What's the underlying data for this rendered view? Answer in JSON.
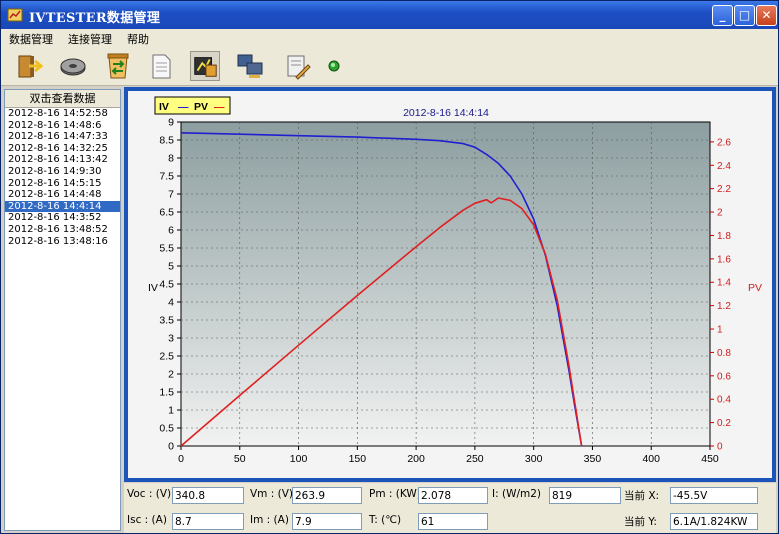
{
  "window": {
    "title": "IVTESTER数据管理",
    "min": "_",
    "max": "□",
    "close": "✕"
  },
  "menu": [
    "数据管理",
    "连接管理",
    "帮助"
  ],
  "toolbar": [
    {
      "name": "exit-icon"
    },
    {
      "name": "disc-icon"
    },
    {
      "name": "trash-recycle-icon"
    },
    {
      "name": "document-icon"
    },
    {
      "name": "curve-chart-icon",
      "pressed": true
    },
    {
      "name": "computer-network-icon"
    },
    {
      "name": "report-edit-icon"
    },
    {
      "name": "status-dot-icon"
    }
  ],
  "records": {
    "header": "双击查看数据",
    "items": [
      "2012-8-16 14:52:58",
      "2012-8-16 14:48:6",
      "2012-8-16 14:47:33",
      "2012-8-16 14:32:25",
      "2012-8-16 14:13:42",
      "2012-8-16 14:9:30",
      "2012-8-16 14:5:15",
      "2012-8-16 14:4:48",
      "2012-8-16 14:4:14",
      "2012-8-16 14:3:52",
      "2012-8-16 13:48:52",
      "2012-8-16 13:48:16"
    ],
    "selected_index": 8
  },
  "legend": {
    "iv": "IV",
    "pv": "PV",
    "dash": "—"
  },
  "colors": {
    "iv": "#2020d0",
    "pv": "#e02020",
    "frame": "#1c54ba",
    "selection": "#316ac5"
  },
  "chart_data": {
    "type": "line",
    "title": "2012-8-16 14:4:14",
    "xlabel": "",
    "ylabel": "IV",
    "y2label": "PV",
    "xlim": [
      0,
      450
    ],
    "ylim": [
      0,
      9
    ],
    "y2lim": [
      0,
      2.77
    ],
    "x_ticks": [
      "0",
      "50",
      "100",
      "150",
      "200",
      "250",
      "300",
      "350",
      "400",
      "450"
    ],
    "y_ticks": [
      "0",
      "0.5",
      "1",
      "1.5",
      "2",
      "2.5",
      "3",
      "3.5",
      "4",
      "4.5",
      "5",
      "5.5",
      "6",
      "6.5",
      "7",
      "7.5",
      "8",
      "8.5",
      "9"
    ],
    "y2_ticks": [
      "0",
      "0.2",
      "0.4",
      "0.6",
      "0.8",
      "1",
      "1.2",
      "1.4",
      "1.6",
      "1.8",
      "2",
      "2.2",
      "2.4",
      "2.6"
    ],
    "grid": true,
    "series": [
      {
        "name": "IV",
        "axis": "left",
        "x": [
          0,
          50,
          100,
          150,
          200,
          220,
          240,
          250,
          260,
          270,
          280,
          290,
          300,
          310,
          320,
          330,
          335,
          340.8
        ],
        "y": [
          8.7,
          8.66,
          8.62,
          8.58,
          8.52,
          8.48,
          8.4,
          8.3,
          8.1,
          7.85,
          7.5,
          7.0,
          6.3,
          5.3,
          3.9,
          2.1,
          1.1,
          0
        ]
      },
      {
        "name": "PV",
        "axis": "right",
        "x": [
          0,
          50,
          100,
          150,
          200,
          220,
          240,
          250,
          260,
          263.9,
          270,
          280,
          290,
          300,
          310,
          320,
          330,
          335,
          340.8
        ],
        "y": [
          0,
          0.433,
          0.862,
          1.287,
          1.704,
          1.866,
          2.016,
          2.075,
          2.106,
          2.078,
          2.12,
          2.1,
          2.03,
          1.89,
          1.64,
          1.25,
          0.69,
          0.37,
          0
        ]
      }
    ]
  },
  "readouts": {
    "voc_label": "Voc : (V)",
    "voc": "340.8",
    "vm_label": "Vm : (V)",
    "vm": "263.9",
    "pm_label": "Pm : (KW)",
    "pm": "2.078",
    "irr_label": "I: (W/m2)",
    "irr": "819",
    "curx_label": "当前 X:",
    "curx": "-45.5V",
    "isc_label": "Isc : (A)",
    "isc": "8.7",
    "im_label": "Im : (A)",
    "im": "7.9",
    "temp_label": "T: (℃)",
    "temp": "61",
    "cury_label": "当前 Y:",
    "cury": "6.1A/1.824KW"
  }
}
